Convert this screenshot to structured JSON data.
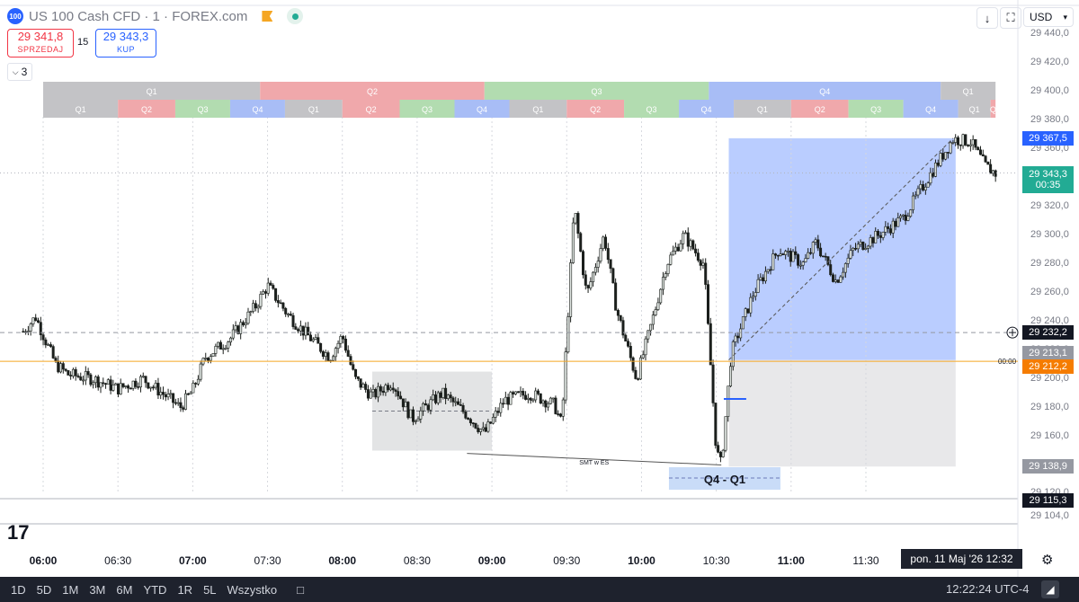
{
  "header": {
    "symbol_badge": "100",
    "title": "US 100 Cash CFD · 1 · FOREX.com",
    "sell_price": "29 341,8",
    "sell_label": "SPRZEDAJ",
    "spread": "15",
    "buy_price": "29 343,3",
    "buy_label": "KUP",
    "indicator_count": "3",
    "currency": "USD"
  },
  "colors": {
    "q1": "#c3c3c6",
    "q2": "#f0a8ab",
    "q3": "#b2dcb0",
    "q4": "#a8bdf6",
    "up": "#dfe5e1",
    "down": "#1b1f1c",
    "orange": "#f5a623",
    "blue": "#2962ff"
  },
  "chart_data": {
    "type": "candlestick",
    "yticks": [
      "29 440,0",
      "29 420,0",
      "29 400,0",
      "29 380,0",
      "29 360,0",
      "29 340,0",
      "29 320,0",
      "29 300,0",
      "29 280,0",
      "29 260,0",
      "29 240,0",
      "29 220,0",
      "29 200,0",
      "29 180,0",
      "29 160,0",
      "29 140,0",
      "29 120,0",
      "29 104,0"
    ],
    "ylim": [
      29100,
      29450
    ],
    "xticks": [
      {
        "t": "06:00",
        "bold": true
      },
      {
        "t": "06:30",
        "bold": false
      },
      {
        "t": "07:00",
        "bold": true
      },
      {
        "t": "07:30",
        "bold": false
      },
      {
        "t": "08:00",
        "bold": true
      },
      {
        "t": "08:30",
        "bold": false
      },
      {
        "t": "09:00",
        "bold": true
      },
      {
        "t": "09:30",
        "bold": false
      },
      {
        "t": "10:00",
        "bold": true
      },
      {
        "t": "10:30",
        "bold": false
      },
      {
        "t": "11:00",
        "bold": true
      },
      {
        "t": "11:30",
        "bold": false
      }
    ],
    "x_range": [
      "05:52",
      "12:35"
    ],
    "quarter_row1": [
      {
        "label": "Q1",
        "q": 1,
        "start": "05:52",
        "end": "07:27"
      },
      {
        "label": "Q2",
        "q": 2,
        "start": "07:27",
        "end": "08:57"
      },
      {
        "label": "Q3",
        "q": 3,
        "start": "08:57",
        "end": "10:27"
      },
      {
        "label": "Q4",
        "q": 4,
        "start": "10:27",
        "end": "12:00"
      },
      {
        "label": "Q1",
        "q": 1,
        "start": "12:00",
        "end": "12:22"
      }
    ],
    "quarter_row2": [
      {
        "label": "Q1",
        "q": 1,
        "start": "05:52",
        "end": "06:30"
      },
      {
        "label": "Q2",
        "q": 2,
        "start": "06:30",
        "end": "06:53"
      },
      {
        "label": "Q3",
        "q": 3,
        "start": "06:53",
        "end": "07:15"
      },
      {
        "label": "Q4",
        "q": 4,
        "start": "07:15",
        "end": "07:37"
      },
      {
        "label": "Q1",
        "q": 1,
        "start": "07:37",
        "end": "08:00"
      },
      {
        "label": "Q2",
        "q": 2,
        "start": "08:00",
        "end": "08:23"
      },
      {
        "label": "Q3",
        "q": 3,
        "start": "08:23",
        "end": "08:45"
      },
      {
        "label": "Q4",
        "q": 4,
        "start": "08:45",
        "end": "09:07"
      },
      {
        "label": "Q1",
        "q": 1,
        "start": "09:07",
        "end": "09:30"
      },
      {
        "label": "Q2",
        "q": 2,
        "start": "09:30",
        "end": "09:53"
      },
      {
        "label": "Q3",
        "q": 3,
        "start": "09:53",
        "end": "10:15"
      },
      {
        "label": "Q4",
        "q": 4,
        "start": "10:15",
        "end": "10:37"
      },
      {
        "label": "Q1",
        "q": 1,
        "start": "10:37",
        "end": "11:00"
      },
      {
        "label": "Q2",
        "q": 2,
        "start": "11:00",
        "end": "11:23"
      },
      {
        "label": "Q3",
        "q": 3,
        "start": "11:23",
        "end": "11:45"
      },
      {
        "label": "Q4",
        "q": 4,
        "start": "11:45",
        "end": "12:07"
      },
      {
        "label": "Q1",
        "q": 1,
        "start": "12:07",
        "end": "12:20"
      },
      {
        "label": "Q",
        "q": 2,
        "start": "12:20",
        "end": "12:22"
      }
    ],
    "price_path": [
      [
        "05:52",
        29233
      ],
      [
        "05:57",
        29243
      ],
      [
        "06:05",
        29210
      ],
      [
        "06:10",
        29203
      ],
      [
        "06:20",
        29200
      ],
      [
        "06:30",
        29193
      ],
      [
        "06:40",
        29200
      ],
      [
        "06:50",
        29187
      ],
      [
        "06:55",
        29180
      ],
      [
        "07:00",
        29192
      ],
      [
        "07:05",
        29215
      ],
      [
        "07:15",
        29228
      ],
      [
        "07:25",
        29250
      ],
      [
        "07:30",
        29265
      ],
      [
        "07:38",
        29245
      ],
      [
        "07:45",
        29232
      ],
      [
        "07:55",
        29215
      ],
      [
        "08:00",
        29230
      ],
      [
        "08:05",
        29200
      ],
      [
        "08:12",
        29188
      ],
      [
        "08:20",
        29198
      ],
      [
        "08:28",
        29172
      ],
      [
        "08:40",
        29190
      ],
      [
        "08:50",
        29175
      ],
      [
        "08:57",
        29162
      ],
      [
        "09:05",
        29185
      ],
      [
        "09:15",
        29190
      ],
      [
        "09:25",
        29182
      ],
      [
        "09:28",
        29168
      ],
      [
        "09:30",
        29230
      ],
      [
        "09:33",
        29320
      ],
      [
        "09:38",
        29258
      ],
      [
        "09:45",
        29300
      ],
      [
        "09:50",
        29248
      ],
      [
        "09:58",
        29200
      ],
      [
        "10:05",
        29245
      ],
      [
        "10:10",
        29280
      ],
      [
        "10:17",
        29300
      ],
      [
        "10:25",
        29280
      ],
      [
        "10:30",
        29150
      ],
      [
        "10:32",
        29140
      ],
      [
        "10:36",
        29218
      ],
      [
        "10:45",
        29260
      ],
      [
        "10:55",
        29290
      ],
      [
        "11:05",
        29280
      ],
      [
        "11:10",
        29295
      ],
      [
        "11:18",
        29268
      ],
      [
        "11:25",
        29290
      ],
      [
        "11:35",
        29300
      ],
      [
        "11:45",
        29312
      ],
      [
        "11:55",
        29340
      ],
      [
        "12:05",
        29367
      ],
      [
        "12:12",
        29365
      ],
      [
        "12:18",
        29348
      ],
      [
        "12:22",
        29343
      ]
    ],
    "candle_count": 390,
    "levels": [
      {
        "name": "current",
        "price": 29343.3,
        "label": "29 343,3",
        "sub": "00:35",
        "color": "#22ab94"
      },
      {
        "name": "high",
        "price": 29367.5,
        "label": "29 367,5",
        "color": "#2962ff"
      },
      {
        "name": "crosshair",
        "price": 29232.2,
        "label": "29 232,2",
        "color": "#131722"
      },
      {
        "name": "entry",
        "price": 29213.1,
        "label": "29 213,1",
        "color": "#9598a1"
      },
      {
        "name": "orange",
        "price": 29212.2,
        "label": "29 212,2",
        "color": "#f57c00"
      },
      {
        "name": "stop",
        "price": 29138.9,
        "label": "29 138,9",
        "color": "#9598a1"
      },
      {
        "name": "low",
        "price": 29115.3,
        "label": "29 115,3",
        "color": "#131722"
      }
    ],
    "orange_line_label": "00:00",
    "range_box": {
      "start": "08:12",
      "end": "09:00",
      "top": 29205,
      "bottom": 29150
    },
    "position": {
      "start": "10:35",
      "end": "12:06",
      "top": 29367.5,
      "entry": 29213.1,
      "stop": 29138.9
    },
    "smt_label": "SMT w ES",
    "smt_line": [
      [
        "08:50",
        29148
      ],
      [
        "10:32",
        29140
      ]
    ],
    "quarter_box_label": "Q4 - Q1",
    "blue_mark": {
      "start": "10:33",
      "end": "10:42",
      "price": 29186
    }
  },
  "bottom": {
    "ranges": [
      "1D",
      "5D",
      "1M",
      "3M",
      "6M",
      "YTD",
      "1R",
      "5L",
      "Wszystko"
    ],
    "clock": "12:22:24 UTC-4",
    "date_label": "pon. 11 Maj '26   12:32"
  }
}
